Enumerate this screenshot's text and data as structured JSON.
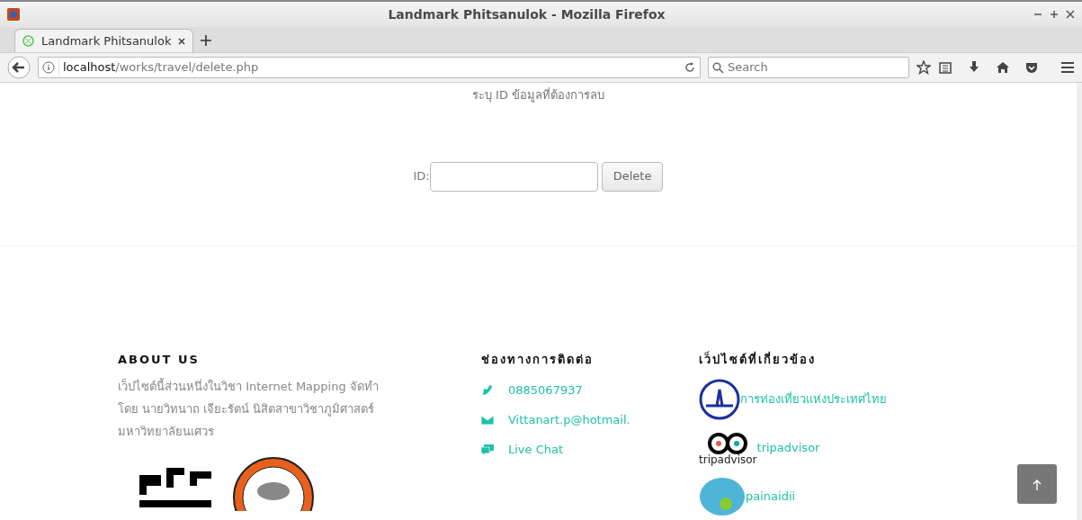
{
  "window": {
    "title": "Landmark Phitsanulok - Mozilla Firefox"
  },
  "tabs": [
    {
      "label": "Landmark Phitsanulok",
      "selected": true
    }
  ],
  "address_bar": {
    "host": "localhost",
    "path": "/works/travel/delete.php"
  },
  "search": {
    "placeholder": "Search"
  },
  "page": {
    "instruction": "ระบุ ID ข้อมูลที่ต้องการลบ",
    "id_label": "ID:",
    "button": "Delete"
  },
  "footer": {
    "about": {
      "heading": "ABOUT US",
      "text": "เว็ปไซต์นี้ส่วนหนึ่งในวิชา Internet Mapping จัดทำโดย นายวิทนาถ เจียะรัตน์ นิสิตสาขาวิชาภูมิศาสตร์ มหาวิทยาลัยนเศวร"
    },
    "contact": {
      "heading": "ช่องทางการติดต่อ",
      "items": [
        {
          "kind": "phone",
          "text": "0885067937"
        },
        {
          "kind": "mail",
          "text": "Vittanart.p@hotmail."
        },
        {
          "kind": "chat",
          "text": "Live Chat"
        }
      ]
    },
    "links": {
      "heading": "เว็ปไซต์ที่เกี่ยวข้อง",
      "items": [
        {
          "kind": "tat",
          "text": "การท่องเที่ยวแห่งประเทศไทย"
        },
        {
          "kind": "tripadvisor",
          "text": "tripadvisor",
          "logo_text": "tripadvisor"
        },
        {
          "kind": "painaidii",
          "text": "painaidii"
        }
      ]
    }
  }
}
